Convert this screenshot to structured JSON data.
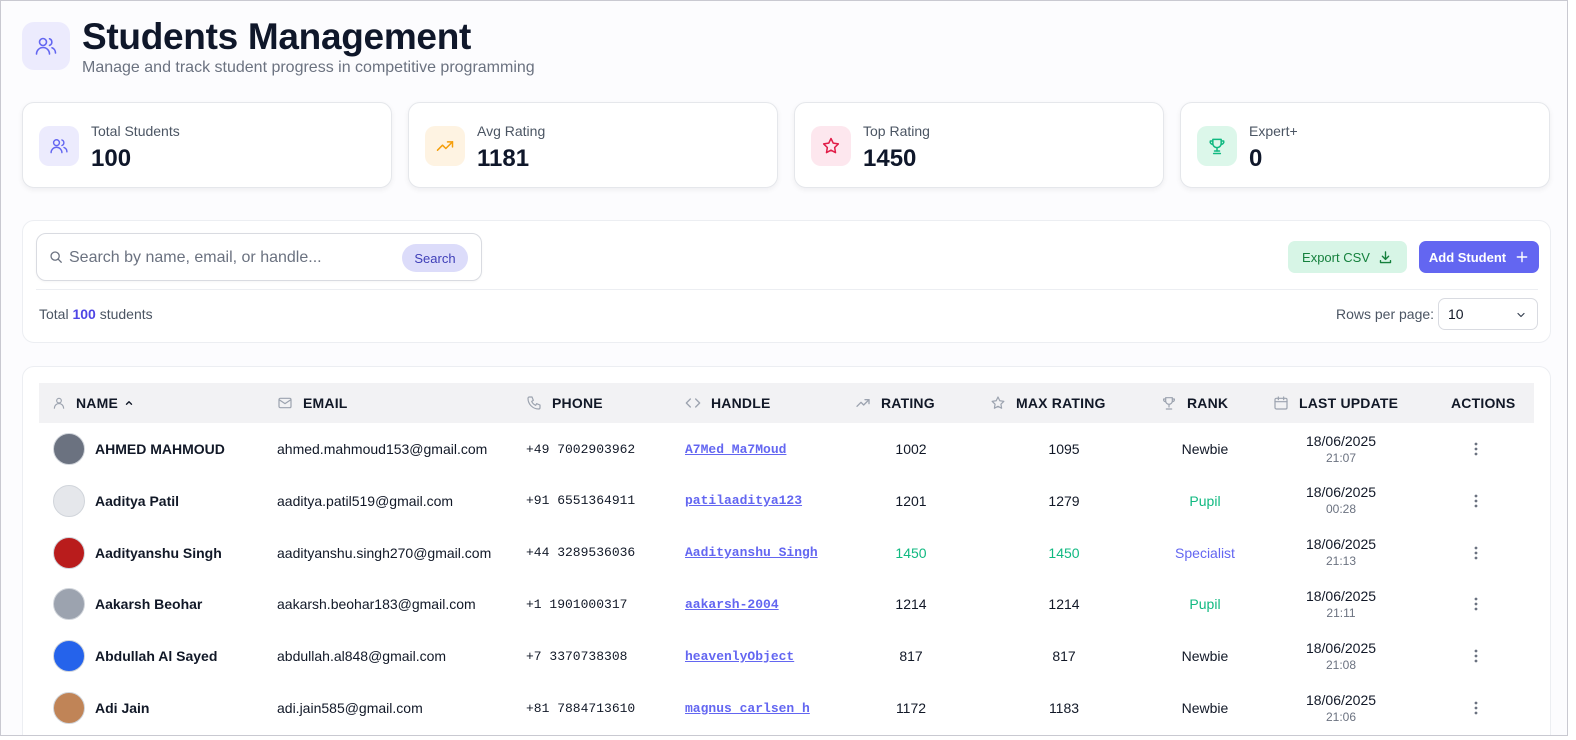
{
  "header": {
    "title": "Students Management",
    "subtitle": "Manage and track student progress in competitive programming"
  },
  "stats": [
    {
      "label": "Total Students",
      "value": "100",
      "icon": "users-icon",
      "bg": "#ecebfd",
      "color": "#6366f1"
    },
    {
      "label": "Avg Rating",
      "value": "1181",
      "icon": "trending-up-icon",
      "bg": "#fef3e2",
      "color": "#f59e0b"
    },
    {
      "label": "Top Rating",
      "value": "1450",
      "icon": "star-icon",
      "bg": "#fde7ee",
      "color": "#e11d48"
    },
    {
      "label": "Expert+",
      "value": "0",
      "icon": "trophy-icon",
      "bg": "#dcf7ea",
      "color": "#10b981"
    }
  ],
  "toolbar": {
    "search_placeholder": "Search by name, email, or handle...",
    "search_value": "",
    "search_button": "Search",
    "export_label": "Export CSV",
    "add_label": "Add Student",
    "total_prefix": "Total",
    "total_count": "100",
    "total_suffix": "students",
    "rows_label": "Rows per page:",
    "rows_value": "10"
  },
  "table": {
    "columns": {
      "name": "NAME",
      "email": "EMAIL",
      "phone": "PHONE",
      "handle": "HANDLE",
      "rating": "RATING",
      "max_rating": "MAX RATING",
      "rank": "RANK",
      "last_update": "LAST UPDATE",
      "actions": "ACTIONS"
    },
    "rows": [
      {
        "name": "AHMED MAHMOUD",
        "email": "ahmed.mahmoud153@gmail.com",
        "phone": "+49 7002903962",
        "handle": "A7Med_Ma7Moud",
        "rating": "1002",
        "max_rating": "1095",
        "rank": "Newbie",
        "date": "18/06/2025",
        "time": "21:07",
        "highlight": false,
        "rank_color": "",
        "avatar_bg": "#6b7280"
      },
      {
        "name": "Aaditya Patil",
        "email": "aaditya.patil519@gmail.com",
        "phone": "+91 6551364911",
        "handle": "patilaaditya123",
        "rating": "1201",
        "max_rating": "1279",
        "rank": "Pupil",
        "date": "18/06/2025",
        "time": "00:28",
        "highlight": false,
        "rank_color": "green",
        "avatar_bg": "#e5e7eb"
      },
      {
        "name": "Aadityanshu Singh",
        "email": "aadityanshu.singh270@gmail.com",
        "phone": "+44 3289536036",
        "handle": "Aadityanshu_Singh",
        "rating": "1450",
        "max_rating": "1450",
        "rank": "Specialist",
        "date": "18/06/2025",
        "time": "21:13",
        "highlight": true,
        "rank_color": "purple",
        "avatar_bg": "#b91c1c"
      },
      {
        "name": "Aakarsh Beohar",
        "email": "aakarsh.beohar183@gmail.com",
        "phone": "+1 1901000317",
        "handle": "aakarsh-2004",
        "rating": "1214",
        "max_rating": "1214",
        "rank": "Pupil",
        "date": "18/06/2025",
        "time": "21:11",
        "highlight": false,
        "rank_color": "green",
        "avatar_bg": "#9ca3af"
      },
      {
        "name": "Abdullah Al Sayed",
        "email": "abdullah.al848@gmail.com",
        "phone": "+7 3370738308",
        "handle": "heavenlyObject",
        "rating": "817",
        "max_rating": "817",
        "rank": "Newbie",
        "date": "18/06/2025",
        "time": "21:08",
        "highlight": false,
        "rank_color": "",
        "avatar_bg": "#2563eb"
      },
      {
        "name": "Adi Jain",
        "email": "adi.jain585@gmail.com",
        "phone": "+81 7884713610",
        "handle": "magnus_carlsen_h",
        "rating": "1172",
        "max_rating": "1183",
        "rank": "Newbie",
        "date": "18/06/2025",
        "time": "21:06",
        "highlight": false,
        "rank_color": "",
        "avatar_bg": "#c08457"
      }
    ]
  }
}
